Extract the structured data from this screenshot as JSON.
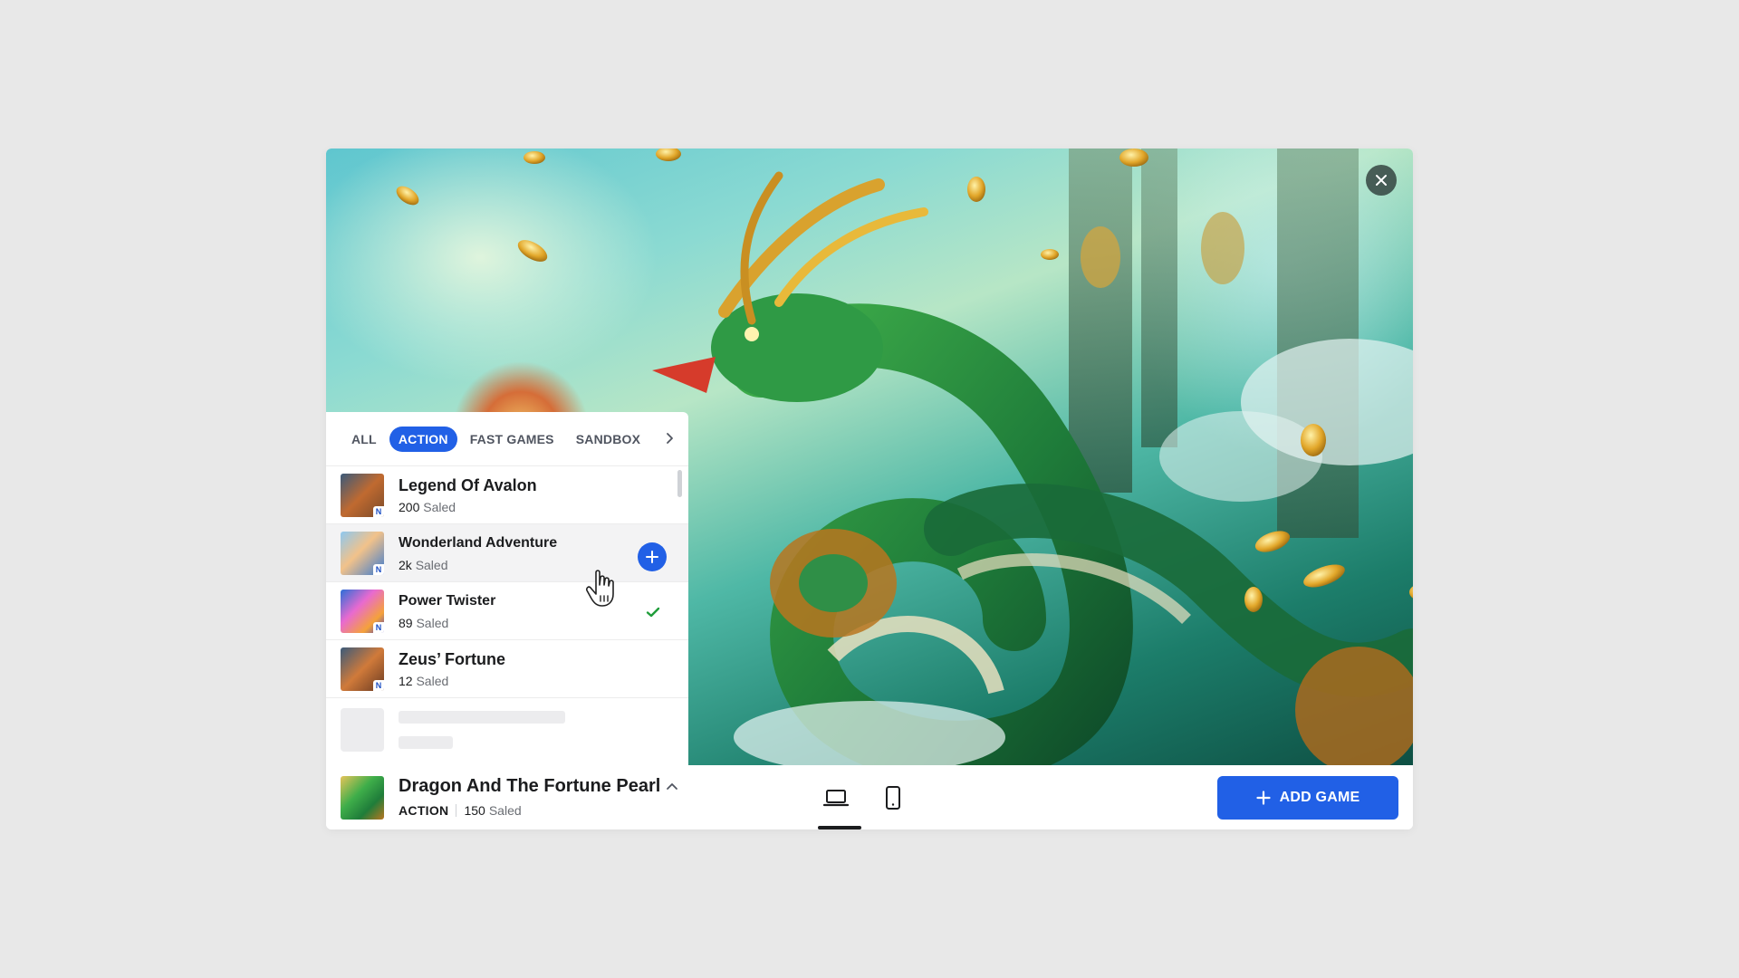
{
  "tabs": [
    {
      "label": "ALL",
      "active": false
    },
    {
      "label": "ACTION",
      "active": true
    },
    {
      "label": "FAST GAMES",
      "active": false
    },
    {
      "label": "SANDBOX",
      "active": false
    }
  ],
  "icons": {
    "close": "close-icon",
    "tab_next": "chevron-right-icon",
    "add": "plus-icon",
    "added": "check-icon",
    "cursor": "hand-pointer-icon",
    "expand": "chevron-up-icon",
    "desktop": "laptop-icon",
    "mobile": "smartphone-icon"
  },
  "games": [
    {
      "title": "Legend Of Avalon",
      "count": "200",
      "suffix": "Saled",
      "badge": "N",
      "state": "none"
    },
    {
      "title": "Wonderland Adventure",
      "count": "2k",
      "suffix": "Saled",
      "badge": "N",
      "state": "add"
    },
    {
      "title": "Power Twister",
      "count": "89",
      "suffix": "Saled",
      "badge": "N",
      "state": "added"
    },
    {
      "title": "Zeus’ Fortune",
      "count": "12",
      "suffix": "Saled",
      "badge": "N",
      "state": "none"
    }
  ],
  "current": {
    "title": "Dragon And The Fortune Pearl",
    "genre": "ACTION",
    "count": "150",
    "suffix": "Saled"
  },
  "add_button": {
    "label": "ADD GAME"
  },
  "colors": {
    "accent": "#2160e6",
    "check": "#1f9d3a",
    "background": "#e8e8e8"
  }
}
